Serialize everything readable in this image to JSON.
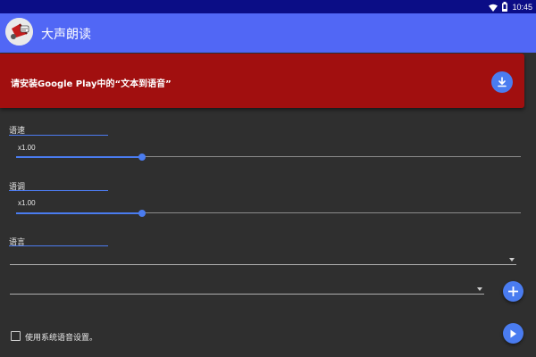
{
  "status_bar": {
    "time": "10:45",
    "icons": [
      "wifi-icon",
      "battery-icon"
    ]
  },
  "app_bar": {
    "title": "大声朗读",
    "logo_icon": "megaphone-icon"
  },
  "banner": {
    "text": "请安装Google Play中的“文本到语音”",
    "action_icon": "download-icon",
    "background_color": "#a10f0f"
  },
  "speed": {
    "label": "语速",
    "value_text": "x1.00",
    "position": 0.25
  },
  "pitch": {
    "label": "语调",
    "value_text": "x1.00",
    "position": 0.25
  },
  "language": {
    "label": "语言",
    "primary_select_value": "",
    "secondary_select_value": "",
    "add_icon": "plus-icon"
  },
  "footer": {
    "system_settings_label": "使用系统语音设置。",
    "system_settings_checked": false,
    "play_icon": "play-icon"
  },
  "colors": {
    "status_bar": "#0b0d86",
    "app_bar": "#5167f5",
    "accent": "#4a7cf0",
    "background": "#2f2f2f"
  }
}
